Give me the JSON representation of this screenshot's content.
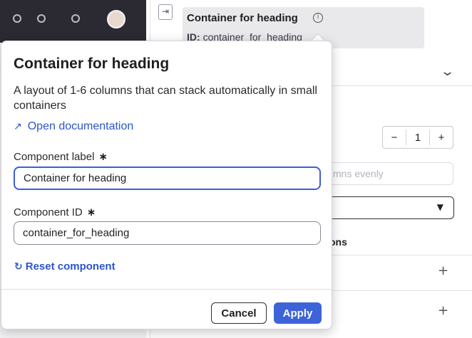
{
  "header": {
    "title": "Container for heading",
    "info_icon": "ⓘ",
    "id_label": "ID:",
    "id_value": "container_for_heading",
    "collapse_icon": "⇥"
  },
  "right_panel": {
    "columns_value": "1",
    "minus_label": "−",
    "plus_label": "+",
    "columns_hint": "mns evenly",
    "section_label": "ons",
    "add_label": "+",
    "expand_icon": "chevron-down-icon"
  },
  "popover": {
    "title": "Container for heading",
    "description": "A layout of 1-6 columns that can stack automatically in small containers",
    "doc_link": "Open documentation",
    "label_field": {
      "label": "Component label",
      "required_mark": "∗",
      "value": "Container for heading"
    },
    "id_field": {
      "label": "Component ID",
      "required_mark": "∗",
      "value": "container_for_heading"
    },
    "reset_label": "Reset component",
    "cancel_label": "Cancel",
    "apply_label": "Apply"
  },
  "colors": {
    "accent": "#3d63d9",
    "link": "#2c55c9",
    "dark_canvas": "#2b2a33"
  }
}
